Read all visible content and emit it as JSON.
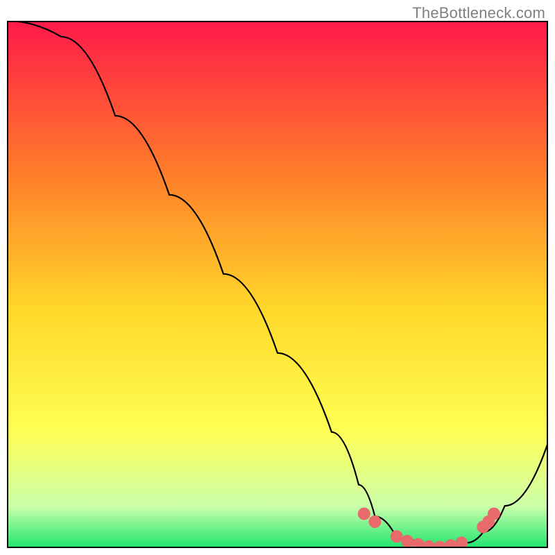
{
  "attribution": "TheBottleneck.com",
  "colors": {
    "gradient_top": "#ff1a4a",
    "gradient_mid_upper": "#ff7a2a",
    "gradient_mid": "#ffd92a",
    "gradient_mid_lower": "#ffff55",
    "gradient_low": "#ccffaa",
    "gradient_bottom": "#1ee66e",
    "curve": "#000000",
    "dots": "#e86a6a",
    "frame": "#000000"
  },
  "chart_data": {
    "type": "line",
    "title": "",
    "xlabel": "",
    "ylabel": "",
    "xlim": [
      0,
      100
    ],
    "ylim": [
      0,
      100
    ],
    "series": [
      {
        "name": "bottleneck-curve",
        "x": [
          0,
          10,
          20,
          30,
          40,
          50,
          60,
          65,
          68,
          72,
          78,
          82,
          85,
          88,
          92,
          100
        ],
        "y": [
          100,
          97,
          82,
          67,
          52,
          37,
          22,
          12,
          6,
          2,
          0,
          0,
          1,
          3,
          8,
          20
        ]
      }
    ],
    "dots": {
      "name": "highlight-dots",
      "points": [
        {
          "x": 66,
          "y": 6.5
        },
        {
          "x": 68,
          "y": 5.0
        },
        {
          "x": 72,
          "y": 2.2
        },
        {
          "x": 74,
          "y": 1.3
        },
        {
          "x": 76,
          "y": 0.7
        },
        {
          "x": 78,
          "y": 0.3
        },
        {
          "x": 80,
          "y": 0.2
        },
        {
          "x": 82,
          "y": 0.5
        },
        {
          "x": 84,
          "y": 1.0
        },
        {
          "x": 88,
          "y": 4.0
        },
        {
          "x": 89,
          "y": 5.0
        },
        {
          "x": 90,
          "y": 6.5
        }
      ]
    }
  }
}
